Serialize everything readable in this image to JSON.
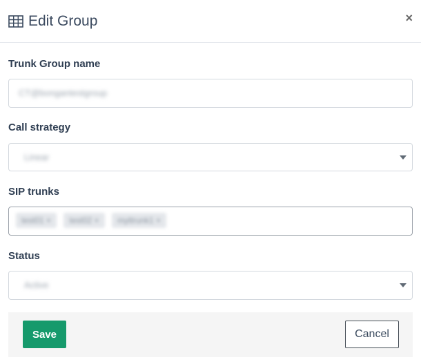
{
  "header": {
    "title": "Edit Group",
    "title_icon": "table-icon",
    "close_label": "×"
  },
  "fields": {
    "name": {
      "label": "Trunk Group name",
      "value": "CT@bongantestgroup"
    },
    "strategy": {
      "label": "Call strategy",
      "value": "Linear"
    },
    "trunks": {
      "label": "SIP trunks",
      "tags": [
        "test01 ×",
        "test02 ×",
        "myttrunk1 ×"
      ]
    },
    "status": {
      "label": "Status",
      "value": "Active"
    }
  },
  "footer": {
    "save_label": "Save",
    "cancel_label": "Cancel"
  },
  "colors": {
    "primary": "#169a6c",
    "title": "#3b4a5f"
  }
}
